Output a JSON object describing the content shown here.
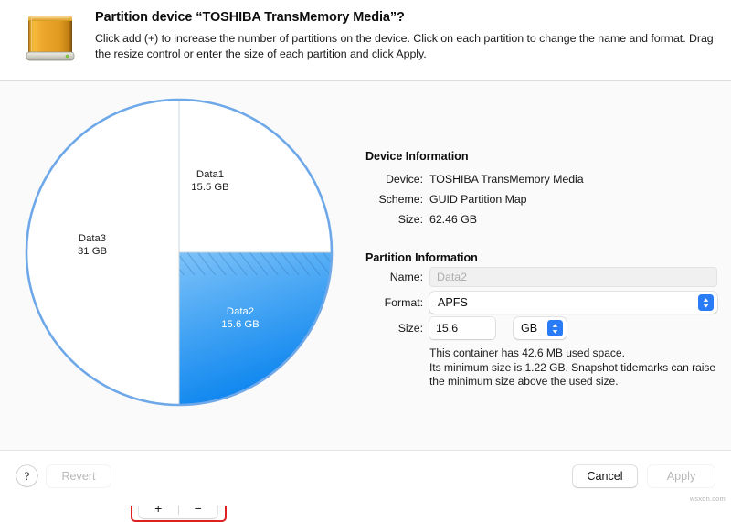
{
  "header": {
    "icon": "external-hard-drive-icon",
    "title": "Partition device “TOSHIBA TransMemory Media”?",
    "message": "Click add (+) to increase the number of partitions on the device. Click on each partition to change the name and format. Drag the resize control or enter the size of each partition and click Apply."
  },
  "chart_data": {
    "type": "pie",
    "title": "",
    "categories": [
      "Data1",
      "Data2",
      "Data3"
    ],
    "values": [
      15.5,
      15.6,
      31
    ],
    "unit": "GB",
    "labels": [
      "15.5 GB",
      "15.6 GB",
      "31 GB"
    ],
    "colors": [
      "#ffffff",
      "#35a0f5",
      "#ffffff"
    ],
    "selected": "Data2",
    "total": 62.1,
    "stroke_color": "#6fa8e8",
    "legend": "none"
  },
  "pie": {
    "slices": [
      {
        "name": "Data1",
        "size": "15.5 GB",
        "selected": false
      },
      {
        "name": "Data3",
        "size": "31 GB",
        "selected": false
      },
      {
        "name": "Data2",
        "size": "15.6 GB",
        "selected": true
      }
    ]
  },
  "segmented": {
    "add_label": "+",
    "remove_label": "−"
  },
  "device_information": {
    "section_title": "Device Information",
    "rows": [
      {
        "label": "Device:",
        "value": "TOSHIBA TransMemory Media"
      },
      {
        "label": "Scheme:",
        "value": "GUID Partition Map"
      },
      {
        "label": "Size:",
        "value": "62.46 GB"
      }
    ]
  },
  "partition_information": {
    "section_title": "Partition Information",
    "name_label": "Name:",
    "name_value": "Data2",
    "format_label": "Format:",
    "format_value": "APFS",
    "size_label": "Size:",
    "size_value": "15.6",
    "unit_value": "GB",
    "hint_line1": "This container has 42.6 MB used space.",
    "hint_line2": "Its minimum size is 1.22 GB. Snapshot tidemarks can raise",
    "hint_line3": "the minimum size above the used size."
  },
  "footer": {
    "help_label": "?",
    "revert_label": "Revert",
    "cancel_label": "Cancel",
    "apply_label": "Apply"
  },
  "watermark": "wsxdn.com"
}
